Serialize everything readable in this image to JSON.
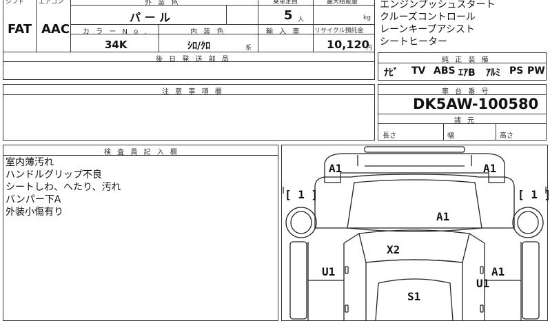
{
  "top_table": {
    "header_shift": "シフト",
    "header_aircon": "エアコン",
    "header_exterior_color": "外 装 色",
    "header_capacity": "乗車定員",
    "header_max_load": "最大積載量",
    "shift_value": "FAT",
    "aircon_value": "AAC",
    "exterior_color_value": "パ ー ル",
    "capacity_value": "5",
    "capacity_unit": "人",
    "max_load_unit": "kg",
    "header_color_no": "カ ラ ー N o .",
    "header_interior_color": "内 装 色",
    "header_import": "輸 入 車",
    "header_recycle_fee": "リサイクル預託金",
    "color_no_value": "34K",
    "interior_color_value": "ｼﾛ/ｸﾛ",
    "interior_color_suffix": "系",
    "recycle_fee_value": "10,120",
    "recycle_fee_unit": "円",
    "header_parts_later": "後 日 発 送 部 品"
  },
  "options_text": {
    "lines": [
      "エンジンプッシュスタート",
      "クルーズコントロール",
      "レーンキープアシスト",
      "シートヒーター"
    ]
  },
  "standard_equipment": {
    "header": "純 正 装 備",
    "items": [
      "ﾅﾋﾞ",
      "TV",
      "ABS",
      "ｴｱB",
      "ｱﾙﾐ",
      "PS",
      "PW"
    ]
  },
  "notes_section": {
    "header": "注 意 事 項 欄"
  },
  "chassis": {
    "header": "車 台 番 号",
    "value": "DK5AW-100580"
  },
  "dimensions": {
    "header": "諸 元",
    "length_label": "長さ",
    "width_label": "幅",
    "height_label": "高さ"
  },
  "inspector": {
    "header": "検 査 員 記 入 欄",
    "lines": [
      "室内薄汚れ",
      "ハンドルグリップ不良",
      "シートしわ、へたり、汚れ",
      "バンパー下A",
      "外装小傷有り"
    ]
  },
  "diagram": {
    "marks": {
      "a1_top_left": "A1",
      "a1_top_right": "A1",
      "bracket_left": "[ 1 ]",
      "bracket_right": "[ 1 ]",
      "a1_hood": "A1",
      "x2": "X2",
      "u1_left": "U1",
      "a1_right_door": "A1",
      "u1_right_door": "U1",
      "s1": "S1"
    }
  }
}
